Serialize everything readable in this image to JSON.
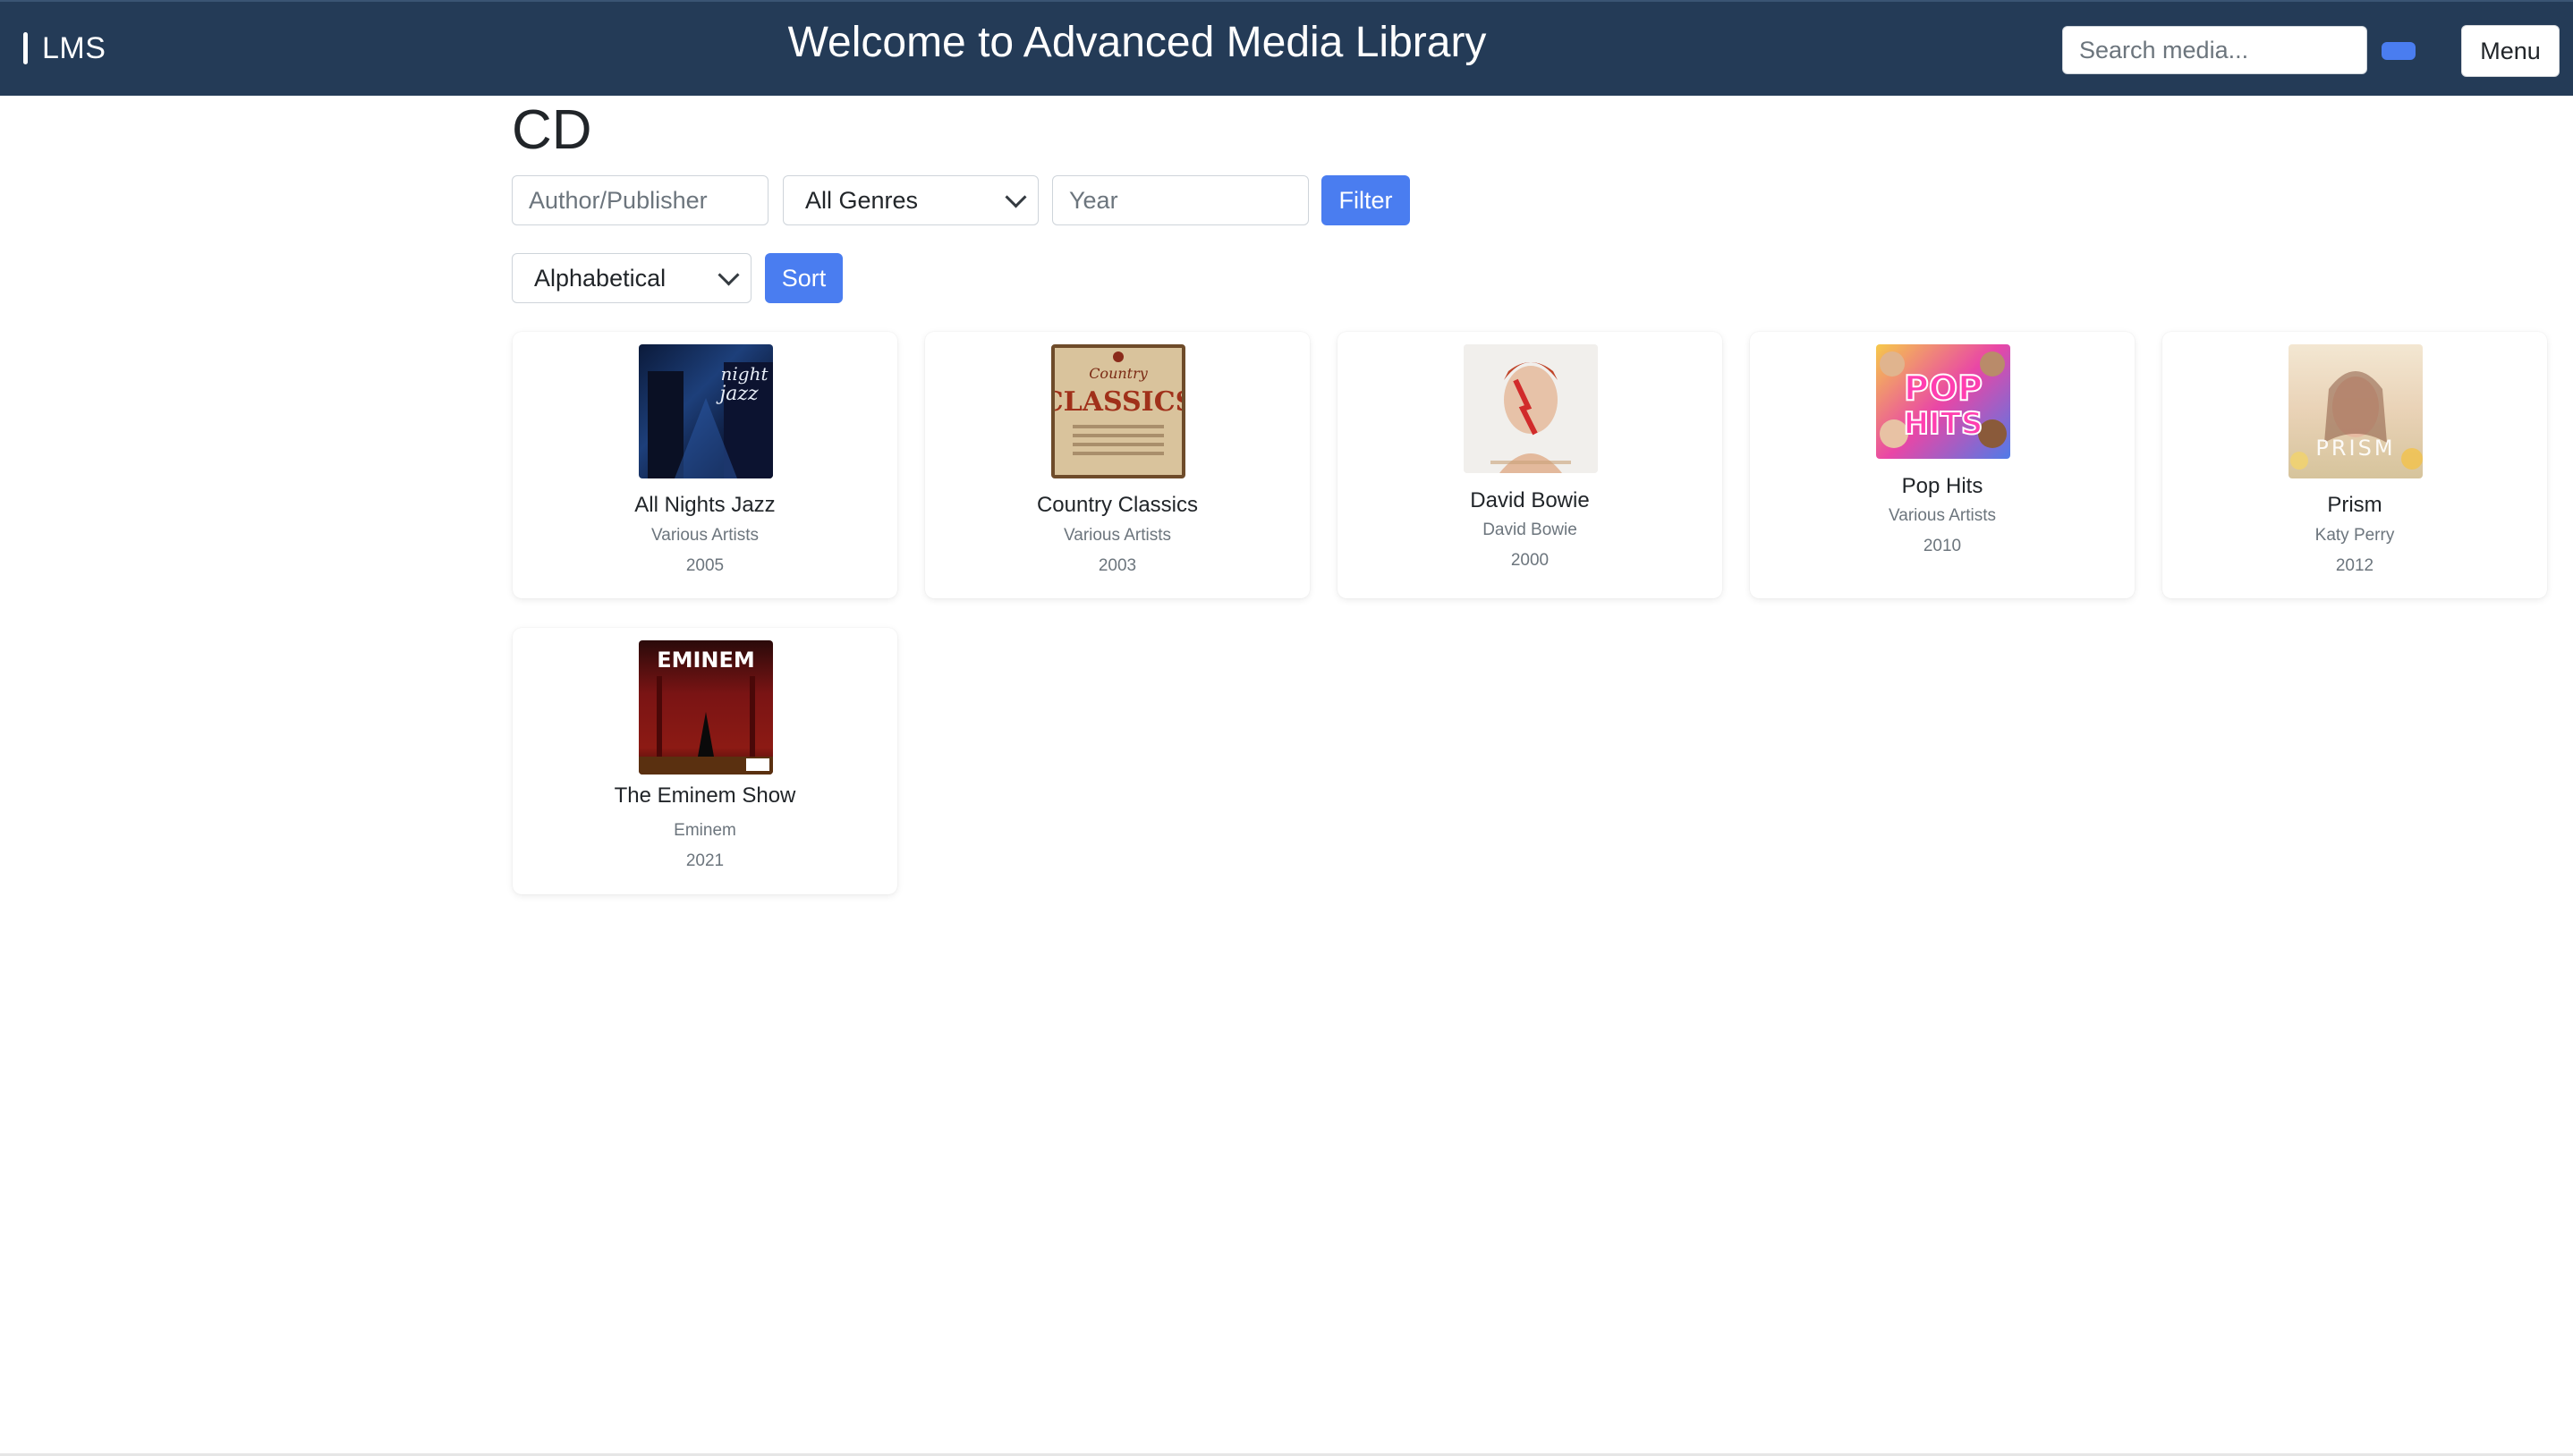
{
  "header": {
    "brand": "LMS",
    "title": "Welcome to Advanced Media Library",
    "search_placeholder": "Search media...",
    "menu_label": "Menu",
    "bg_color": "#243b57",
    "accent_color": "#4a7df0"
  },
  "page": {
    "title": "CD"
  },
  "filters": {
    "author_placeholder": "Author/Publisher",
    "genre_selected": "All Genres",
    "year_placeholder": "Year",
    "filter_label": "Filter",
    "sort_selected": "Alphabetical",
    "sort_label": "Sort"
  },
  "items": [
    {
      "title": "All Nights Jazz",
      "artist": "Various Artists",
      "year": "2005",
      "cover_text": "all night jazz"
    },
    {
      "title": "Country Classics",
      "artist": "Various Artists",
      "year": "2003",
      "cover_text": "COUNTRY CLASSICS"
    },
    {
      "title": "David Bowie",
      "artist": "David Bowie",
      "year": "2000",
      "cover_text": ""
    },
    {
      "title": "Pop Hits",
      "artist": "Various Artists",
      "year": "2010",
      "cover_text": "POP HITS"
    },
    {
      "title": "Prism",
      "artist": "Katy Perry",
      "year": "2012",
      "cover_text": "PRISM"
    },
    {
      "title": "The Eminem Show",
      "artist": "Eminem",
      "year": "2021",
      "cover_text": "EMINEM"
    }
  ]
}
